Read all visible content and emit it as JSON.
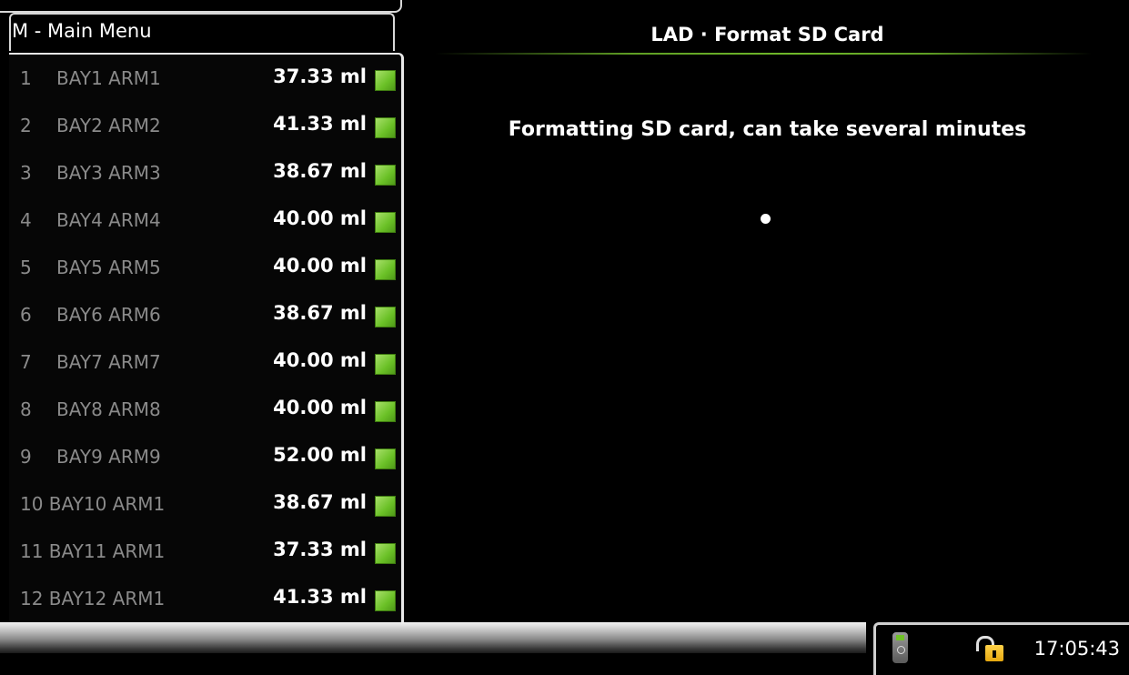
{
  "menu": {
    "title": "M - Main Menu"
  },
  "screen": {
    "title": "LAD · Format SD Card",
    "message": "Formatting SD card, can take several minutes"
  },
  "rows": [
    {
      "num": "1",
      "name": "BAY1 ARM1",
      "volume": "37.33 ml"
    },
    {
      "num": "2",
      "name": "BAY2 ARM2",
      "volume": "41.33 ml"
    },
    {
      "num": "3",
      "name": "BAY3 ARM3",
      "volume": "38.67 ml"
    },
    {
      "num": "4",
      "name": "BAY4 ARM4",
      "volume": "40.00 ml"
    },
    {
      "num": "5",
      "name": "BAY5 ARM5",
      "volume": "40.00 ml"
    },
    {
      "num": "6",
      "name": "BAY6 ARM6",
      "volume": "38.67 ml"
    },
    {
      "num": "7",
      "name": "BAY7 ARM7",
      "volume": "40.00 ml"
    },
    {
      "num": "8",
      "name": "BAY8 ARM8",
      "volume": "40.00 ml"
    },
    {
      "num": "9",
      "name": "BAY9 ARM9",
      "volume": "52.00 ml"
    },
    {
      "num": "",
      "name": "10 BAY10 ARM1",
      "volume": "38.67 ml"
    },
    {
      "num": "",
      "name": "11 BAY11 ARM1",
      "volume": "37.33 ml"
    },
    {
      "num": "",
      "name": "12 BAY12 ARM1",
      "volume": "41.33 ml"
    }
  ],
  "status_bar": {
    "clock": "17:05:43",
    "device_icon": "handheld-device-icon",
    "lock_icon": "unlocked-padlock-icon"
  },
  "colors": {
    "indicator_green": "#6ac026",
    "title_underline": "#6fb82a",
    "lock_yellow": "#ffd24a"
  }
}
